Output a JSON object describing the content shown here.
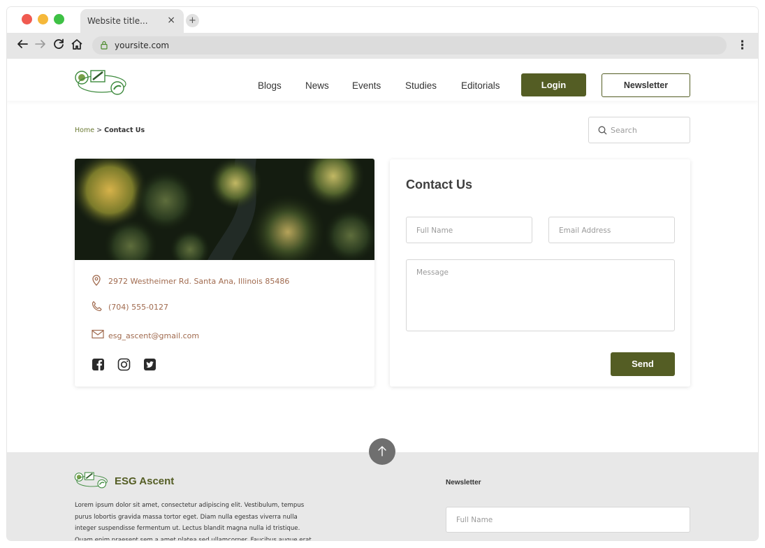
{
  "browser": {
    "tab_title": "Website title...",
    "tab_close": "×",
    "new_tab": "+",
    "url": "yoursite.com"
  },
  "header": {
    "nav": [
      "Blogs",
      "News",
      "Events",
      "Studies",
      "Editorials"
    ],
    "login_label": "Login",
    "newsletter_label": "Newsletter"
  },
  "breadcrumb": {
    "home": "Home",
    "separator": ">",
    "current": "Contact Us"
  },
  "search": {
    "placeholder": "Search"
  },
  "contact_info": {
    "address": "2972 Westheimer Rd. Santa Ana, Illinois 85486",
    "phone": "(704) 555-0127",
    "email": "esg_ascent@gmail.com",
    "social": [
      "facebook-icon",
      "instagram-icon",
      "twitter-icon"
    ]
  },
  "form": {
    "title": "Contact Us",
    "full_name_placeholder": "Full Name",
    "email_placeholder": "Email Address",
    "message_placeholder": "Message",
    "send_label": "Send"
  },
  "footer": {
    "brand": "ESG Ascent",
    "about_lines": [
      "Lorem ipsum dolor sit amet, consectetur adipiscing elit. Vestibulum, tempus",
      "purus lobortis gravida massa tortor eget. Diam nulla egestas viverra nulla",
      "integer suspendisse fermentum ut. Lectus blandit magna nulla id tristique.",
      "Quam enim praesent sem a amet platea sed ullamcorper. Faucibus augue erat"
    ],
    "newsletter_title": "Newsletter",
    "newsletter_name_placeholder": "Full Name",
    "to_top": "↑"
  },
  "colors": {
    "accent": "#545d24",
    "accent_light": "#6b7a33",
    "info_text": "#a06a4e",
    "footer_bg": "#e8e8e8"
  }
}
